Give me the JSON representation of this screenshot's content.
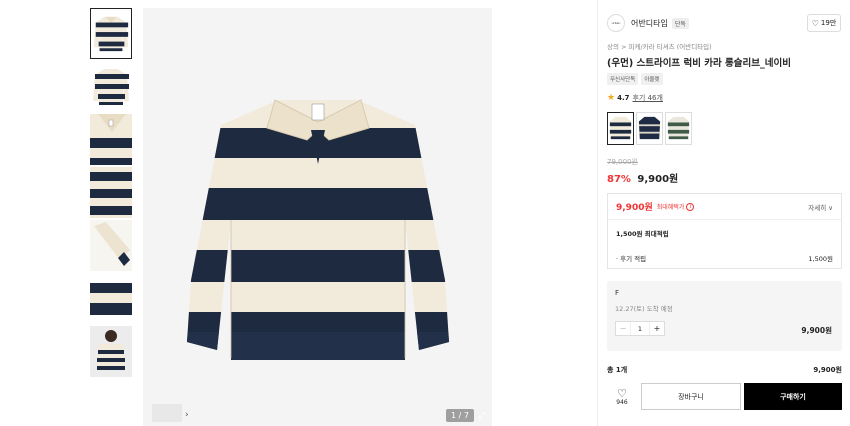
{
  "gallery": {
    "thumbnail_count": 7,
    "active_thumbnail": 1,
    "counter": "1 / 7"
  },
  "brand": {
    "logo_text": "urban",
    "name": "어반디타입",
    "badge": "단독",
    "likes": "19만"
  },
  "breadcrumb": "상의 > 피케/카라 티셔츠 (어반디타입)",
  "product": {
    "title": "(우먼) 스트라이프 럭비 카라 롱슬리브_네이비",
    "tags": [
      "무신사단독",
      "아울렛"
    ],
    "rating": "4.7",
    "review_link": "후기 46개",
    "original_price": "79,000원",
    "discount": "87%",
    "price": "9,900원"
  },
  "swatches": [
    {
      "name": "네이비",
      "stripe": "#1e2a3f",
      "base": "#f2ebdb",
      "selected": true
    },
    {
      "name": "네이비2",
      "stripe": "#1f2b45",
      "base": "#1f2b45",
      "selected": false
    },
    {
      "name": "그린",
      "stripe": "#3f5a47",
      "base": "#e9e7dd",
      "selected": false
    }
  ],
  "benefit": {
    "price": "9,900원",
    "label": "최대혜택가",
    "info_icon": "info-icon",
    "detail": "자세히 ∨",
    "points_label": "1,500원 최대적립",
    "review_points_label": "· 후기 적립",
    "review_points_value": "1,500원"
  },
  "option": {
    "name": "F",
    "shipping": "12.27(토) 도착 예정",
    "minus": "−",
    "quantity": "1",
    "plus": "+",
    "price": "9,900원"
  },
  "total": {
    "label": "총 1개",
    "value": "9,900원"
  },
  "actions": {
    "wish_count": "946",
    "cart_label": "장바구니",
    "buy_label": "구매하기"
  },
  "colors": {
    "navy": "#1e2a3f",
    "cream": "#f2ebdb",
    "accent_red": "#f03333"
  }
}
